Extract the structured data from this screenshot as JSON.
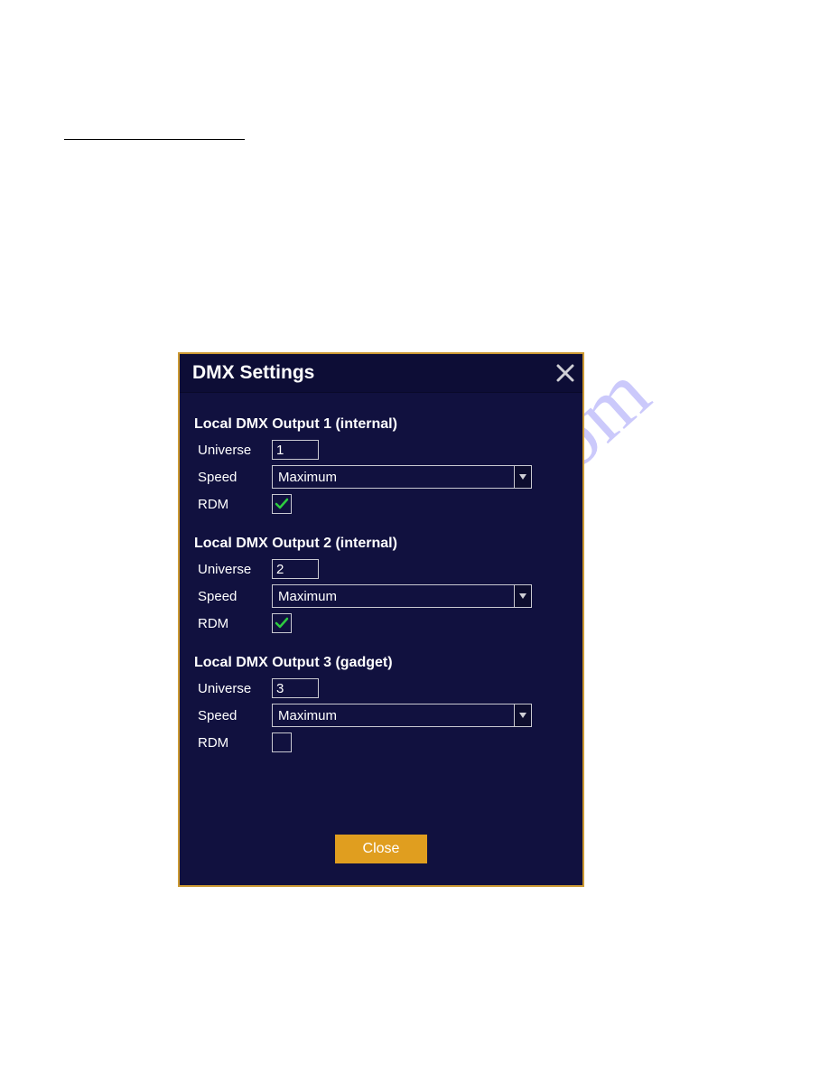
{
  "watermark": "manualshive.com",
  "dialog": {
    "title": "DMX Settings",
    "closeButtonLabel": "Close",
    "labels": {
      "universe": "Universe",
      "speed": "Speed",
      "rdm": "RDM"
    },
    "outputs": [
      {
        "heading": "Local DMX Output 1 (internal)",
        "universe": "1",
        "speed": "Maximum",
        "rdm": true
      },
      {
        "heading": "Local DMX Output 2 (internal)",
        "universe": "2",
        "speed": "Maximum",
        "rdm": true
      },
      {
        "heading": "Local DMX Output 3 (gadget)",
        "universe": "3",
        "speed": "Maximum",
        "rdm": false
      }
    ]
  }
}
